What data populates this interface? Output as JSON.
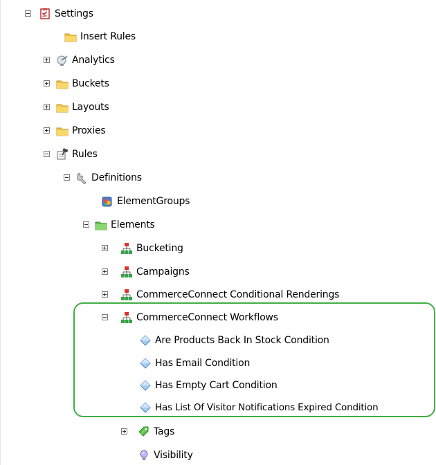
{
  "tree": {
    "settings": "Settings",
    "insert_rules": "Insert Rules",
    "analytics": "Analytics",
    "buckets": "Buckets",
    "layouts": "Layouts",
    "proxies": "Proxies",
    "rules": "Rules",
    "definitions": "Definitions",
    "element_groups": "ElementGroups",
    "elements": "Elements",
    "bucketing": "Bucketing",
    "campaigns": "Campaigns",
    "cc_conditional_renderings": "CommerceConnect Conditional Renderings",
    "cc_workflows": "CommerceConnect Workflows",
    "are_products_back": "Are Products Back In Stock Condition",
    "has_email": "Has Email Condition",
    "has_empty_cart": "Has Empty Cart Condition",
    "has_list_visitor": "Has List Of Visitor Notifications Expired Condition",
    "tags": "Tags",
    "visibility": "Visibility"
  },
  "colors": {
    "highlight": "#3fae44",
    "folder": "#f5c542",
    "folder_green": "#5cc24a",
    "rule_red": "#d9342b",
    "rule_green": "#3aa24a",
    "diamond": "#7fb2e8"
  }
}
